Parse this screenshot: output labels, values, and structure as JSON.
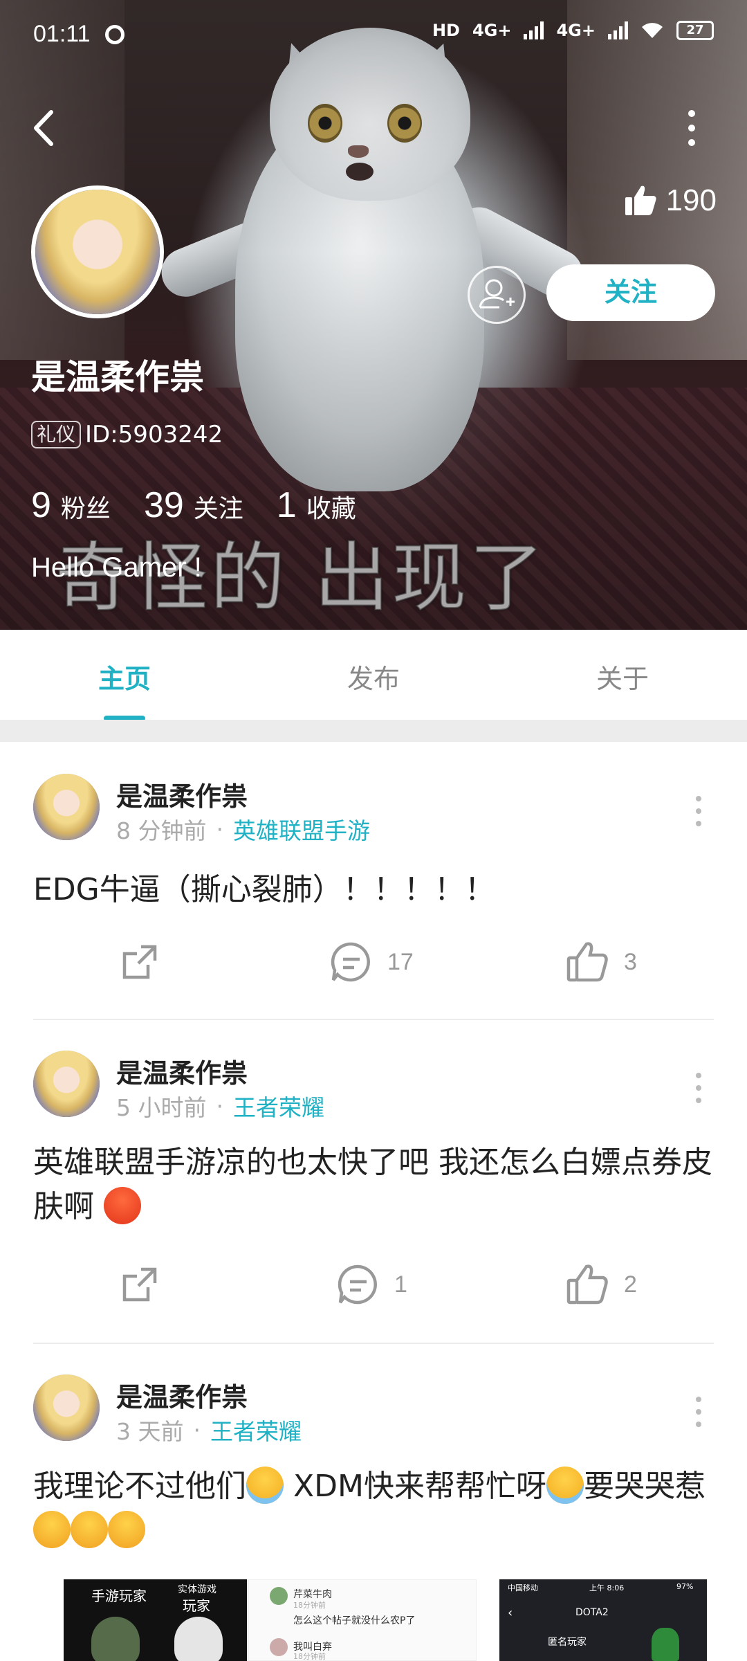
{
  "status_bar": {
    "time": "01:11",
    "network1": "4G+",
    "network2": "4G+",
    "hd": "HD",
    "battery": "27"
  },
  "header": {
    "like_count": "190",
    "follow_label": "关注",
    "user_name": "是温柔作祟",
    "badge": "礼仪",
    "id_text": "ID:5903242",
    "bio": "Hello Gamer !",
    "subtitle_overlay": "奇怪的   出现了",
    "stats": [
      {
        "num": "9",
        "label": "粉丝"
      },
      {
        "num": "39",
        "label": "关注"
      },
      {
        "num": "1",
        "label": "收藏"
      }
    ]
  },
  "tabs": [
    {
      "label": "主页",
      "active": true
    },
    {
      "label": "发布",
      "active": false
    },
    {
      "label": "关于",
      "active": false
    }
  ],
  "posts": [
    {
      "author": "是温柔作祟",
      "time": "8 分钟前",
      "dot": "·",
      "game": "英雄联盟手游",
      "text": "EDG牛逼（撕心裂肺）！！！！！",
      "comments": "17",
      "likes": "3"
    },
    {
      "author": "是温柔作祟",
      "time": "5 小时前",
      "dot": "·",
      "game": "王者荣耀",
      "text": "英雄联盟手游凉的也太快了吧 我还怎么白嫖点券皮肤啊",
      "comments": "1",
      "likes": "2"
    },
    {
      "author": "是温柔作祟",
      "time": "3 天前",
      "dot": "·",
      "game": "王者荣耀",
      "text_part1": "我理论不过他们",
      "text_part2": " XDM快来帮帮忙呀",
      "text_part3": "要哭哭惹"
    }
  ],
  "thumbnails": {
    "t1_label_a": "手游玩家",
    "t1_label_b": "实体游戏",
    "t1_label_c": "玩家",
    "t2_user1": "芹菜牛肉",
    "t2_time1": "18分钟前",
    "t2_text1": "怎么这个帖子就没什么农P了",
    "t2_user2": "我叫白弃",
    "t2_time2": "18分钟前",
    "t3_carrier": "中国移动",
    "t3_time": "上午 8:06",
    "t3_battery": "97%",
    "t3_title": "DOTA2",
    "t3_name": "匿名玩家"
  },
  "icons": {
    "back": "chevron-left-icon",
    "more": "more-vertical-icon",
    "like": "thumb-up-icon",
    "add_friend": "add-user-icon",
    "share": "share-icon",
    "comment": "comment-icon"
  },
  "colors": {
    "accent": "#20b2c4",
    "muted": "#999999"
  }
}
